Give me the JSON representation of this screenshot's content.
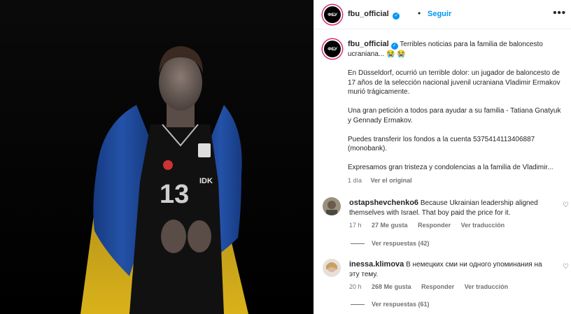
{
  "post": {
    "username": "fbu_official",
    "avatar_text": "ФБУ",
    "separator": "•",
    "follow_label": "Seguir",
    "more_label": "•••",
    "verified_icon": "check"
  },
  "caption": {
    "username": "fbu_official",
    "line1": "Terribles noticias para la familia de baloncesto ucraniana... 😭 😭",
    "para1": "En Düsseldorf, ocurrió un terrible dolor: un jugador de baloncesto de 17 años de la selección nacional juvenil ucraniana Vladimir Ermakov murió trágicamente.",
    "para2": "Una gran petición a todos para ayudar a su familia - Tatiana Gnatyuk y Gennady Ermakov.",
    "para3": "Puedes transferir los fondos a la cuenta 5375414113406887 (monobank).",
    "para4": "Expresamos gran tristeza y condolencias a la familia de Vladimir...",
    "time": "1 día",
    "translate": "Ver el original"
  },
  "comments": [
    {
      "username": "ostapshevchenko6",
      "text": "Because Ukrainian leadership aligned themselves with Israel. That boy paid the price for it.",
      "time": "17 h",
      "likes": "27 Me gusta",
      "reply": "Responder",
      "translate": "Ver traducción",
      "replies": "Ver respuestas (42)"
    },
    {
      "username": "inessa.klimova",
      "text": "В немецких сми ни одного упоминания на эту тему.",
      "time": "20 h",
      "likes": "268 Me gusta",
      "reply": "Responder",
      "translate": "Ver traducción",
      "replies": "Ver respuestas (61)"
    }
  ],
  "jersey": {
    "number": "13",
    "sponsor": "IDK"
  },
  "colors": {
    "flag_blue": "#1f4ea8",
    "flag_yellow": "#d9b21a",
    "link_blue": "#0095f6",
    "meta_gray": "#737373"
  }
}
